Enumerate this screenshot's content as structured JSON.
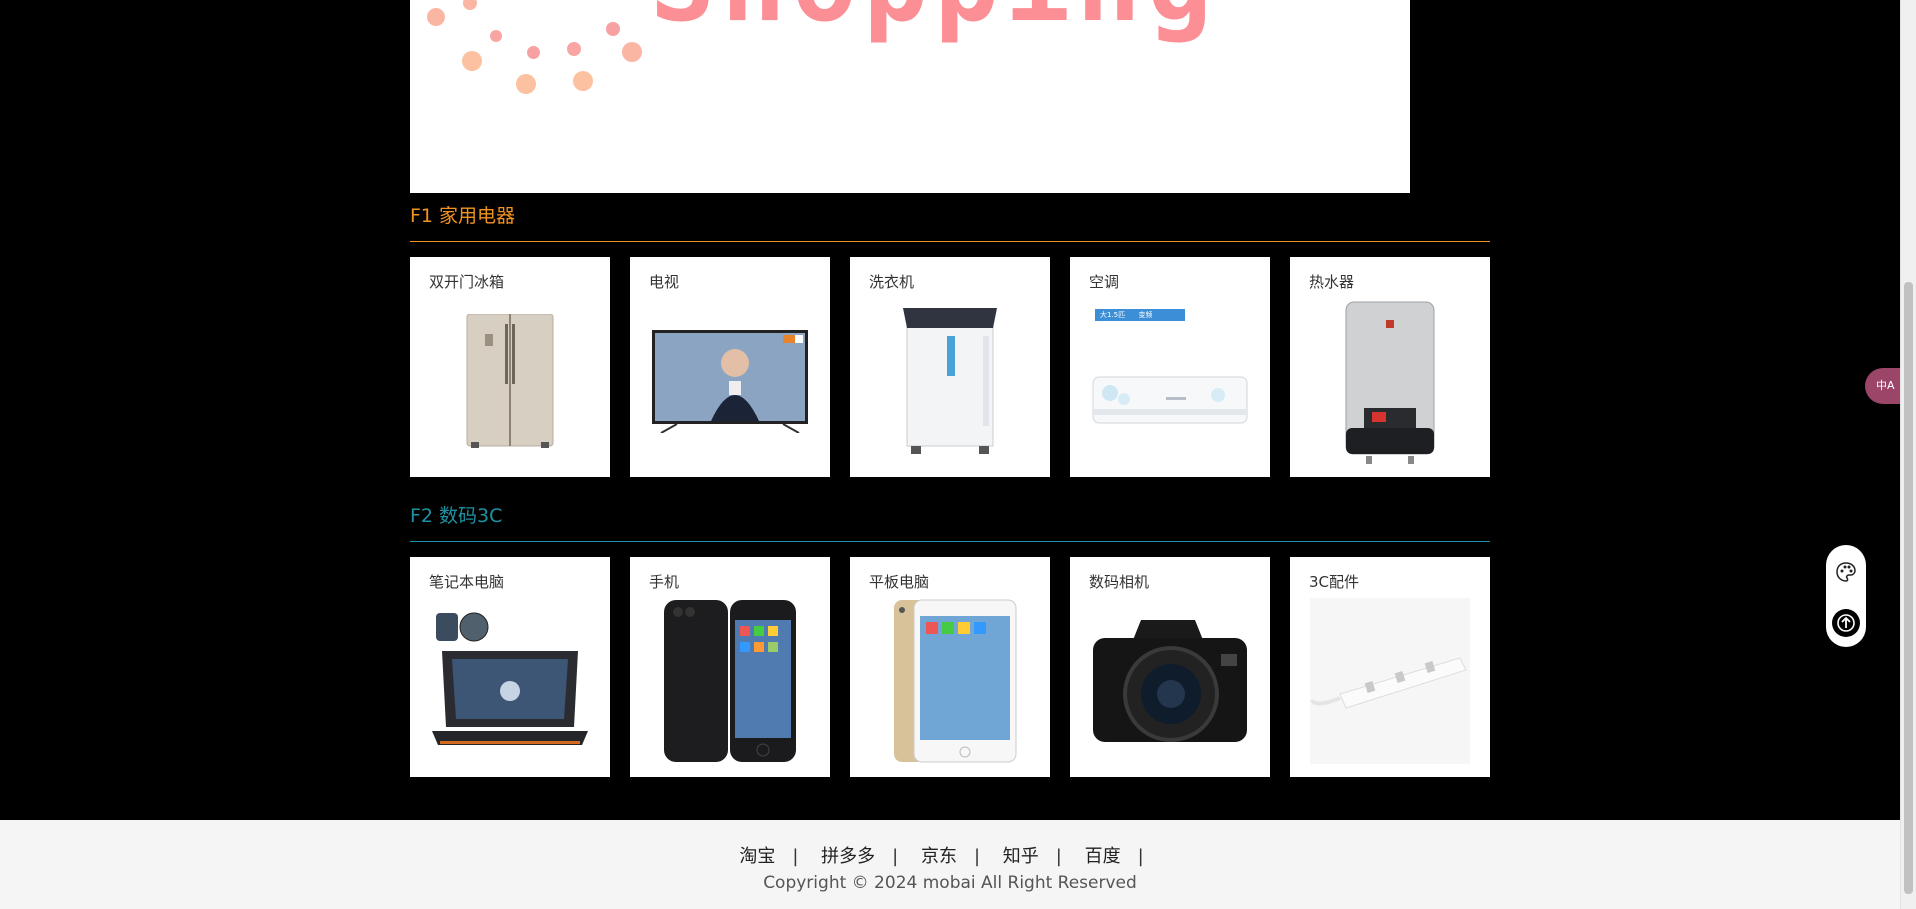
{
  "banner": {
    "word": "Shopping"
  },
  "floors": [
    {
      "title": "F1 家用电器",
      "accent": "#f19321",
      "items": [
        {
          "label": "双开门冰箱",
          "icon": "fridge-image"
        },
        {
          "label": "电视",
          "icon": "tv-image"
        },
        {
          "label": "洗衣机",
          "icon": "washing-machine-image"
        },
        {
          "label": "空调",
          "icon": "air-conditioner-image"
        },
        {
          "label": "热水器",
          "icon": "water-heater-image"
        }
      ],
      "ac_badge": "大1.5匹",
      "ac_badge2": "变频"
    },
    {
      "title": "F2 数码3C",
      "accent": "#1d92a4",
      "items": [
        {
          "label": "笔记本电脑",
          "icon": "laptop-image"
        },
        {
          "label": "手机",
          "icon": "phone-image"
        },
        {
          "label": "平板电脑",
          "icon": "tablet-image"
        },
        {
          "label": "数码相机",
          "icon": "camera-image"
        },
        {
          "label": "3C配件",
          "icon": "power-strip-image"
        }
      ]
    }
  ],
  "footer": {
    "links": [
      "淘宝",
      "拼多多",
      "京东",
      "知乎",
      "百度"
    ],
    "separator": "|",
    "copyright": "Copyright © 2024 mobai All Right Reserved"
  },
  "tools": {
    "translate_label": "中A"
  }
}
